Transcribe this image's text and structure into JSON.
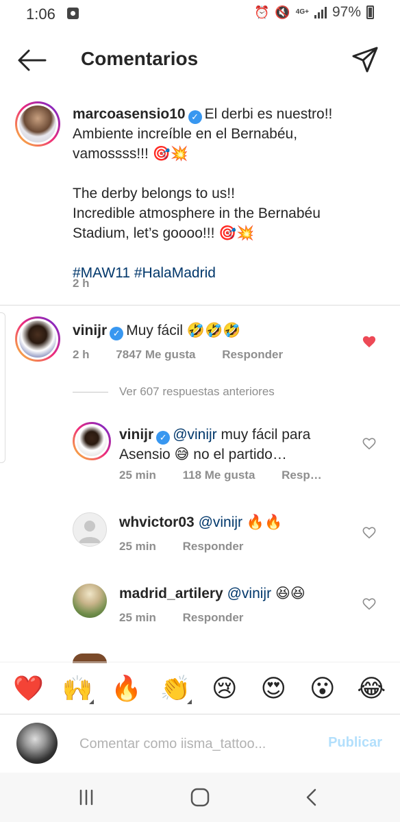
{
  "status_bar": {
    "time": "1:06",
    "network": "4G+",
    "battery": "97%",
    "icons": [
      "gallery-notification-icon",
      "alarm-icon",
      "mute-icon",
      "signal-icon",
      "battery-charging-icon"
    ]
  },
  "header": {
    "title": "Comentarios",
    "back_icon": "arrow-left-icon",
    "share_icon": "paper-plane-icon"
  },
  "caption": {
    "username": "marcoasensio10",
    "text_line1": "El derbi es nuestro!!",
    "text_line2": "Ambiente increíble en el Bernabéu,",
    "text_line3": "vamossss!!! 🎯💥",
    "text_line4": "The derby belongs to us!!",
    "text_line5": "Incredible atmosphere in the Bernabéu",
    "text_line6": "Stadium, let’s goooo!!! 🎯💥",
    "hashtags": "#MAW11 #HalaMadrid",
    "time": "2 h"
  },
  "comments": [
    {
      "username": "vinijr",
      "text": "Muy fácil 🤣🤣🤣",
      "time": "2 h",
      "likes": "7847 Me gusta",
      "reply": "Responder",
      "liked": true,
      "like_color": "#ed4956"
    }
  ],
  "view_replies": "Ver 607 respuestas anteriores",
  "replies": [
    {
      "username": "vinijr",
      "mention": "@vinijr",
      "text_line1": "muy fácil para",
      "text_line2": "Asensio 😅 no el partido…",
      "time": "25 min",
      "likes": "118 Me gusta",
      "reply": "Resp…"
    },
    {
      "username": "whvictor03",
      "mention": "@vinijr",
      "text": "🔥🔥",
      "time": "25 min",
      "reply": "Responder"
    },
    {
      "username": "madrid_artilery",
      "mention": "@vinijr",
      "text": "😆😆",
      "time": "25 min",
      "reply": "Responder"
    }
  ],
  "emoji_bar": [
    "❤️",
    "🙌",
    "🔥",
    "👏",
    "😢",
    "😍",
    "😮",
    "😂"
  ],
  "input": {
    "placeholder": "Comentar como iisma_tattoo...",
    "publish": "Publicar"
  },
  "nav": {
    "recents_icon": "recents-icon",
    "home_icon": "home-icon",
    "back_icon": "back-chevron-icon"
  }
}
